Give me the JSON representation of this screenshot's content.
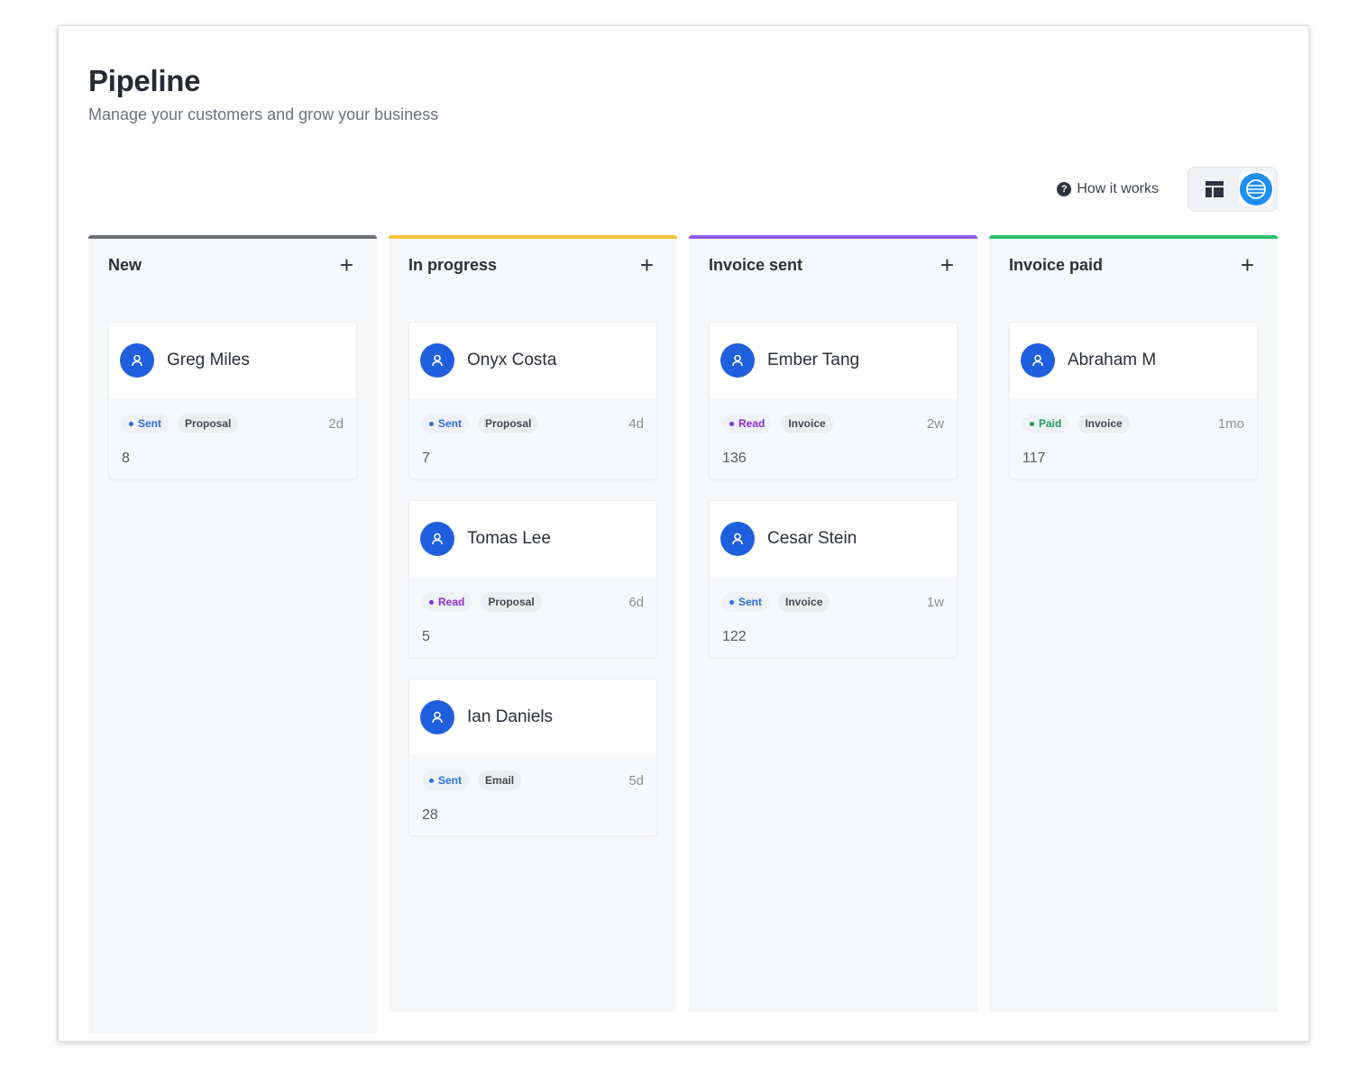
{
  "header": {
    "title": "Pipeline",
    "subtitle": "Manage your customers and grow your business"
  },
  "toolbar": {
    "how_it_works": "How it works",
    "help_icon": "question-circle-icon",
    "view_options": [
      "board-layout-icon",
      "globe-icon"
    ]
  },
  "colors": {
    "accent": "#1f5fde",
    "status_sent": "#2f6fe4",
    "status_read": "#8a2fd6",
    "status_paid": "#1f9a55"
  },
  "columns": [
    {
      "title": "New",
      "accent": "#6b6f76",
      "add_label": "+",
      "cards": [
        {
          "name": "Greg Miles",
          "status": "Sent",
          "status_color": "#2f6fe4",
          "type": "Proposal",
          "age": "2d",
          "count": "8"
        }
      ]
    },
    {
      "title": "In progress",
      "accent": "#f2c23a",
      "add_label": "+",
      "cards": [
        {
          "name": "Onyx Costa",
          "status": "Sent",
          "status_color": "#2f6fe4",
          "type": "Proposal",
          "age": "4d",
          "count": "7"
        },
        {
          "name": "Tomas Lee",
          "status": "Read",
          "status_color": "#8a2fd6",
          "type": "Proposal",
          "age": "6d",
          "count": "5"
        },
        {
          "name": "Ian Daniels",
          "status": "Sent",
          "status_color": "#2f6fe4",
          "type": "Email",
          "age": "5d",
          "count": "28"
        }
      ]
    },
    {
      "title": "Invoice sent",
      "accent": "#8b5cf6",
      "add_label": "+",
      "cards": [
        {
          "name": "Ember Tang",
          "status": "Read",
          "status_color": "#8a2fd6",
          "type": "Invoice",
          "age": "2w",
          "count": "136"
        },
        {
          "name": "Cesar Stein",
          "status": "Sent",
          "status_color": "#2f6fe4",
          "type": "Invoice",
          "age": "1w",
          "count": "122"
        }
      ]
    },
    {
      "title": "Invoice paid",
      "accent": "#2fbf71",
      "add_label": "+",
      "cards": [
        {
          "name": "Abraham M",
          "status": "Paid",
          "status_color": "#1f9a55",
          "type": "Invoice",
          "age": "1mo",
          "count": "117"
        }
      ]
    }
  ]
}
